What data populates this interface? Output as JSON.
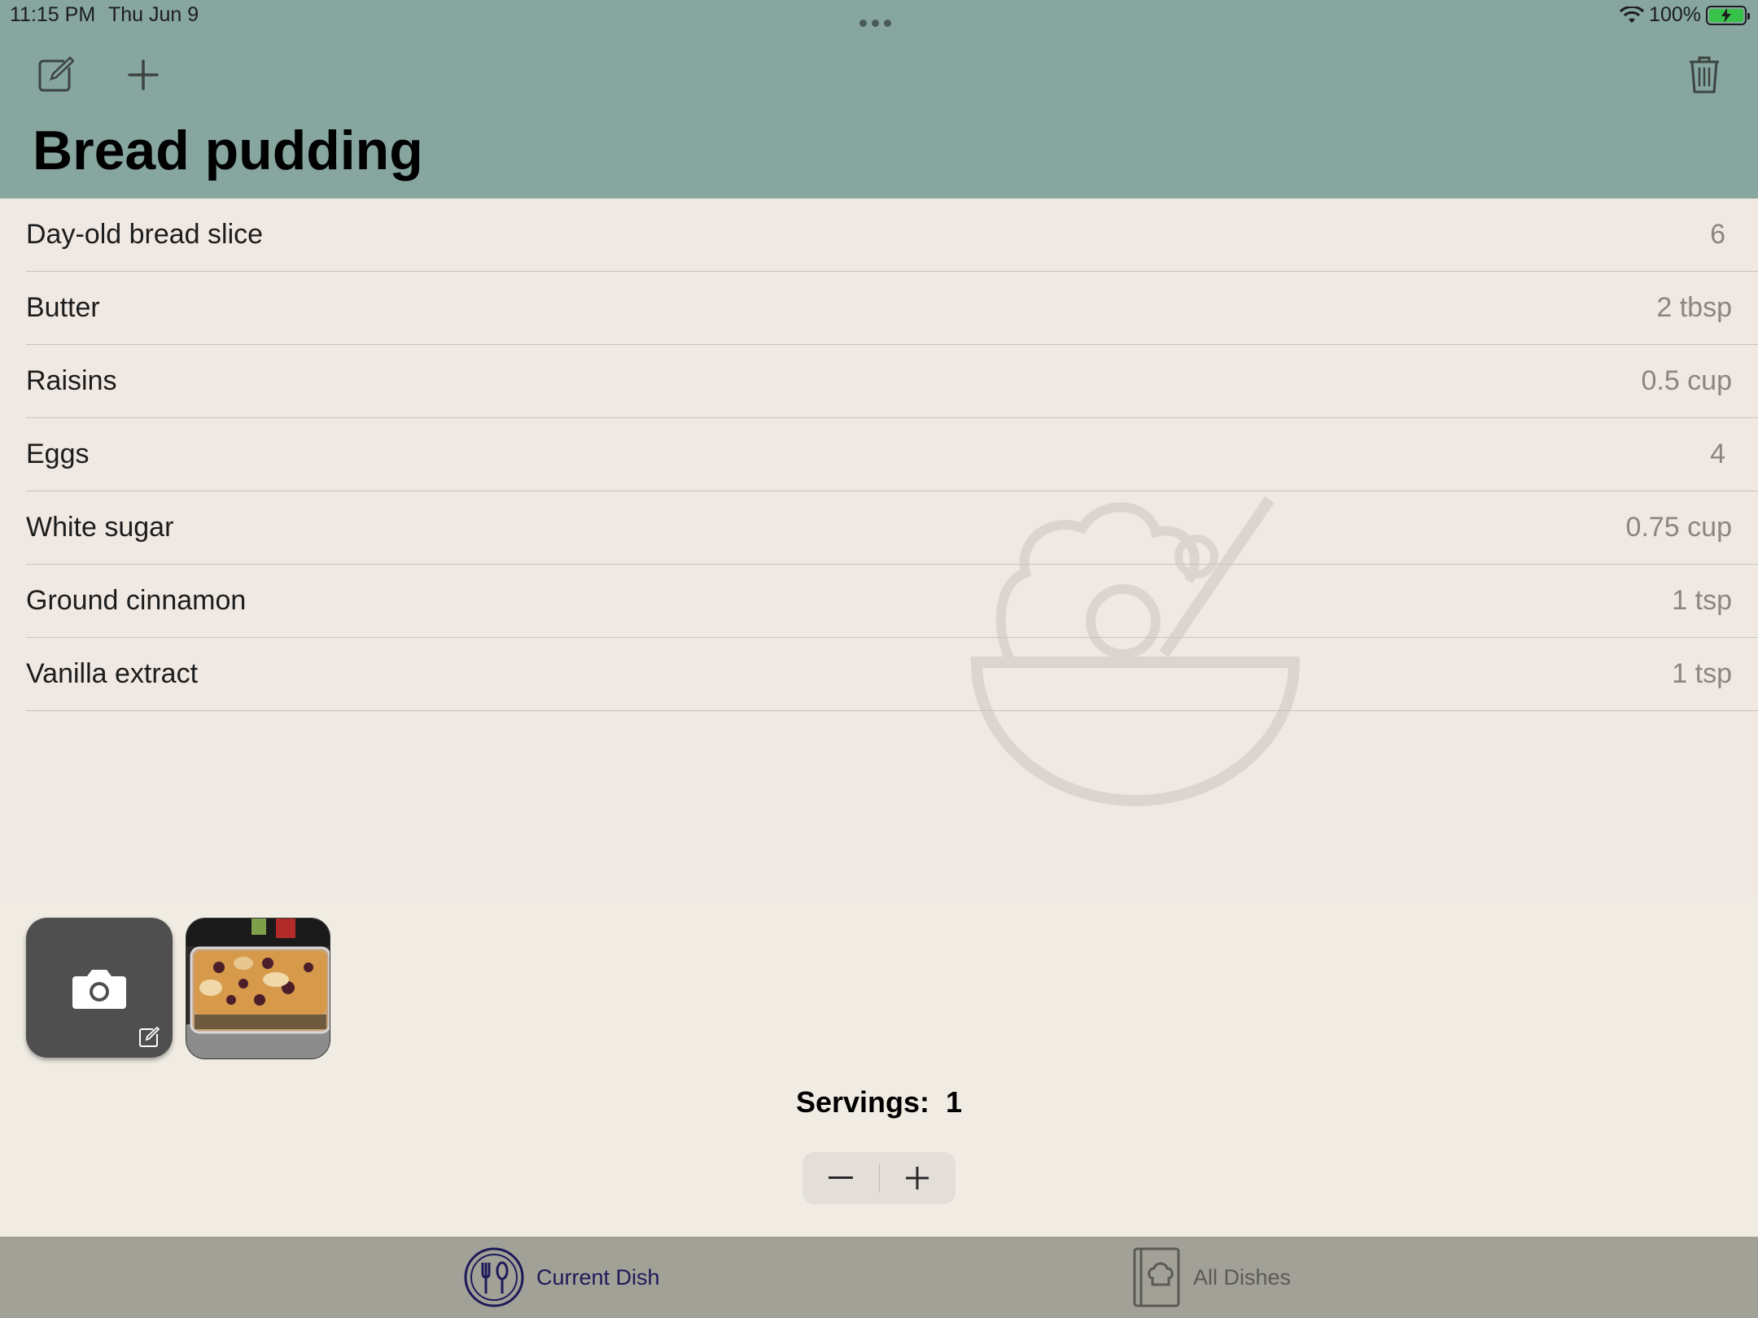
{
  "status_bar": {
    "time": "11:15 PM",
    "date": "Thu Jun 9",
    "battery": "100%"
  },
  "toolbar": {
    "edit_icon": "compose-icon",
    "add_icon": "plus-icon",
    "delete_icon": "trash-icon"
  },
  "dish": {
    "title": "Bread pudding"
  },
  "ingredients": [
    {
      "name": "Day-old bread slice",
      "qty": "6"
    },
    {
      "name": "Butter",
      "qty": "2 tbsp"
    },
    {
      "name": "Raisins",
      "qty": "0.5 cup"
    },
    {
      "name": "Eggs",
      "qty": "4"
    },
    {
      "name": "White sugar",
      "qty": "0.75 cup"
    },
    {
      "name": "Ground cinnamon",
      "qty": "1 tsp"
    },
    {
      "name": "Vanilla extract",
      "qty": "1 tsp"
    }
  ],
  "photos": {
    "add_icon": "camera-icon"
  },
  "servings": {
    "label": "Servings:",
    "value": "1",
    "minus": "−",
    "plus": "+"
  },
  "tabs": [
    {
      "label": "Current Dish",
      "icon": "utensils-icon",
      "selected": true
    },
    {
      "label": "All Dishes",
      "icon": "recipe-book-icon",
      "selected": false
    }
  ],
  "colors": {
    "header": "#86a69f",
    "list_bg": "#f0e8e2",
    "tab_bar": "#a2a197",
    "accent": "#1d1a5a"
  }
}
